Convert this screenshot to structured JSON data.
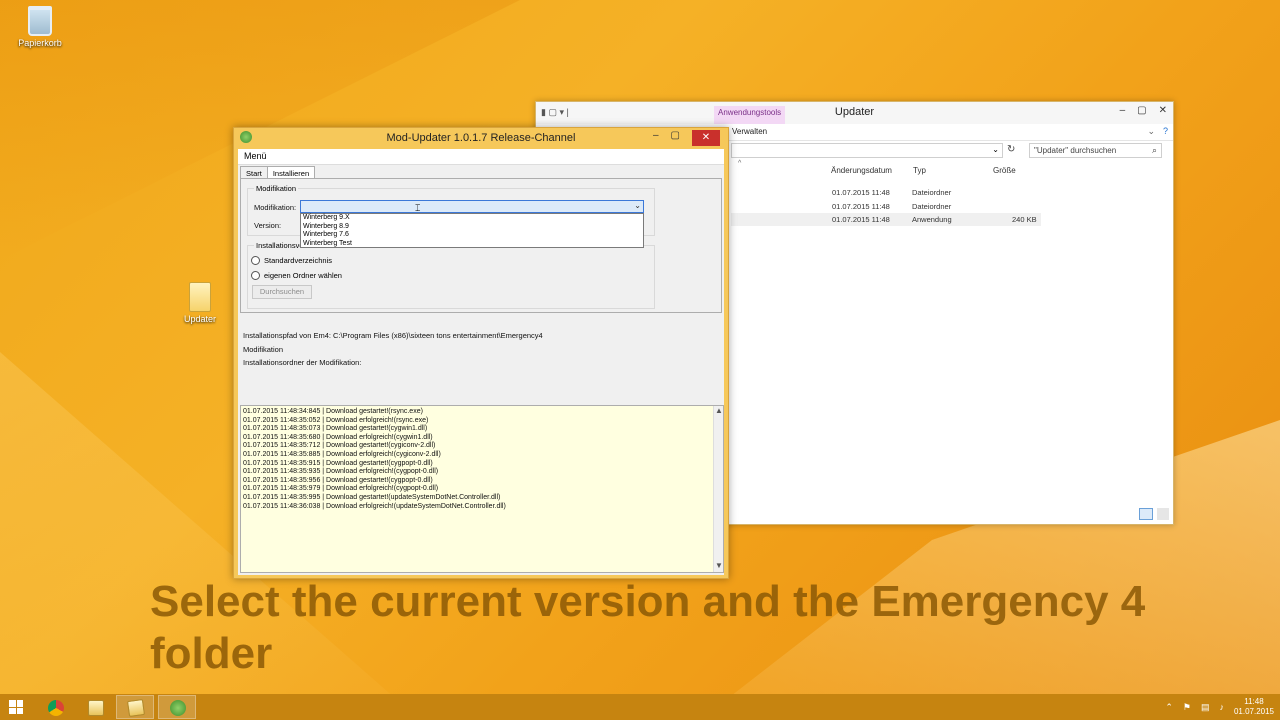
{
  "desktop": {
    "icons": [
      {
        "label": "Papierkorb"
      },
      {
        "label": "Updater"
      }
    ]
  },
  "explorer": {
    "title": "Updater",
    "context_tab": "Anwendungstools",
    "ribbon_verwalten": "Verwalten",
    "search_placeholder": "\"Updater\" durchsuchen",
    "columns": [
      "Änderungsdatum",
      "Typ",
      "Größe"
    ],
    "rows": [
      {
        "date": "01.07.2015 11:48",
        "type": "Dateiordner",
        "size": ""
      },
      {
        "date": "01.07.2015 11:48",
        "type": "Dateiordner",
        "size": ""
      },
      {
        "date": "01.07.2015 11:48",
        "type": "Anwendung",
        "size": "240 KB"
      }
    ]
  },
  "mod_updater": {
    "title": "Mod-Updater 1.0.1.7 Release-Channel",
    "menu": "Menü",
    "tabs": [
      "Start",
      "Installieren"
    ],
    "group_modifikation": "Modifikation",
    "label_modifikation": "Modifikation:",
    "label_version": "Version:",
    "dropdown_options": [
      "Winterberg 9.X",
      "Winterberg 8.9",
      "Winterberg 7.6",
      "Winterberg Test"
    ],
    "group_install": "Installationsverzeichnis",
    "radio_standard": "Standardverzeichnis",
    "radio_custom": "eigenen Ordner wählen",
    "browse_button": "Durchsuchen",
    "info_path": "Installationspfad von Em4: C:\\Program Files (x86)\\sixteen tons entertainment\\Emergency4",
    "info_mod": "Modifikation",
    "info_folder": "Installationsordner der Modifikation:",
    "log": [
      "01.07.2015 11:48:34:845 | Download gestartet!(rsync.exe)",
      "01.07.2015 11:48:35:052 | Download erfolgreich!(rsync.exe)",
      "01.07.2015 11:48:35:073 | Download gestartet!(cygwin1.dll)",
      "01.07.2015 11:48:35:680 | Download erfolgreich!(cygwin1.dll)",
      "01.07.2015 11:48:35:712 | Download gestartet!(cygiconv-2.dll)",
      "01.07.2015 11:48:35:885 | Download erfolgreich!(cygiconv-2.dll)",
      "01.07.2015 11:48:35:915 | Download gestartet!(cygpopt-0.dll)",
      "01.07.2015 11:48:35:935 | Download erfolgreich!(cygpopt-0.dll)",
      "01.07.2015 11:48:35:956 | Download gestartet!(cygpopt-0.dll)",
      "01.07.2015 11:48:35:979 | Download erfolgreich!(cygpopt-0.dll)",
      "01.07.2015 11:48:35:995 | Download gestartet!(updateSystemDotNet.Controller.dll)",
      "01.07.2015 11:48:36:038 | Download erfolgreich!(updateSystemDotNet.Controller.dll)"
    ]
  },
  "caption": "Select the current version and the Emergency 4 folder",
  "taskbar": {
    "time": "11:48",
    "date": "01.07.2015"
  },
  "colors": {
    "desktop": "#f5b126",
    "taskbar": "#c68410",
    "close_button": "#c9302c"
  }
}
